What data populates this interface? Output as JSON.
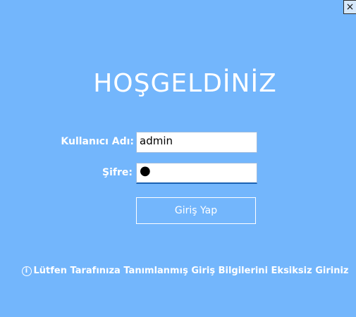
{
  "window": {
    "close_symbol": "×"
  },
  "header": {
    "title": "HOŞGELDİNİZ"
  },
  "form": {
    "username_label": "Kullanıcı Adı:",
    "username_value": "admin",
    "password_label": "Şifre:",
    "password_value": "●",
    "login_button": "Giriş Yap"
  },
  "footer": {
    "info_icon": "info-icon",
    "info_text": "Lütfen Tarafınıza Tanımlanmış Giriş Bilgilerini Eksiksiz Giriniz"
  }
}
